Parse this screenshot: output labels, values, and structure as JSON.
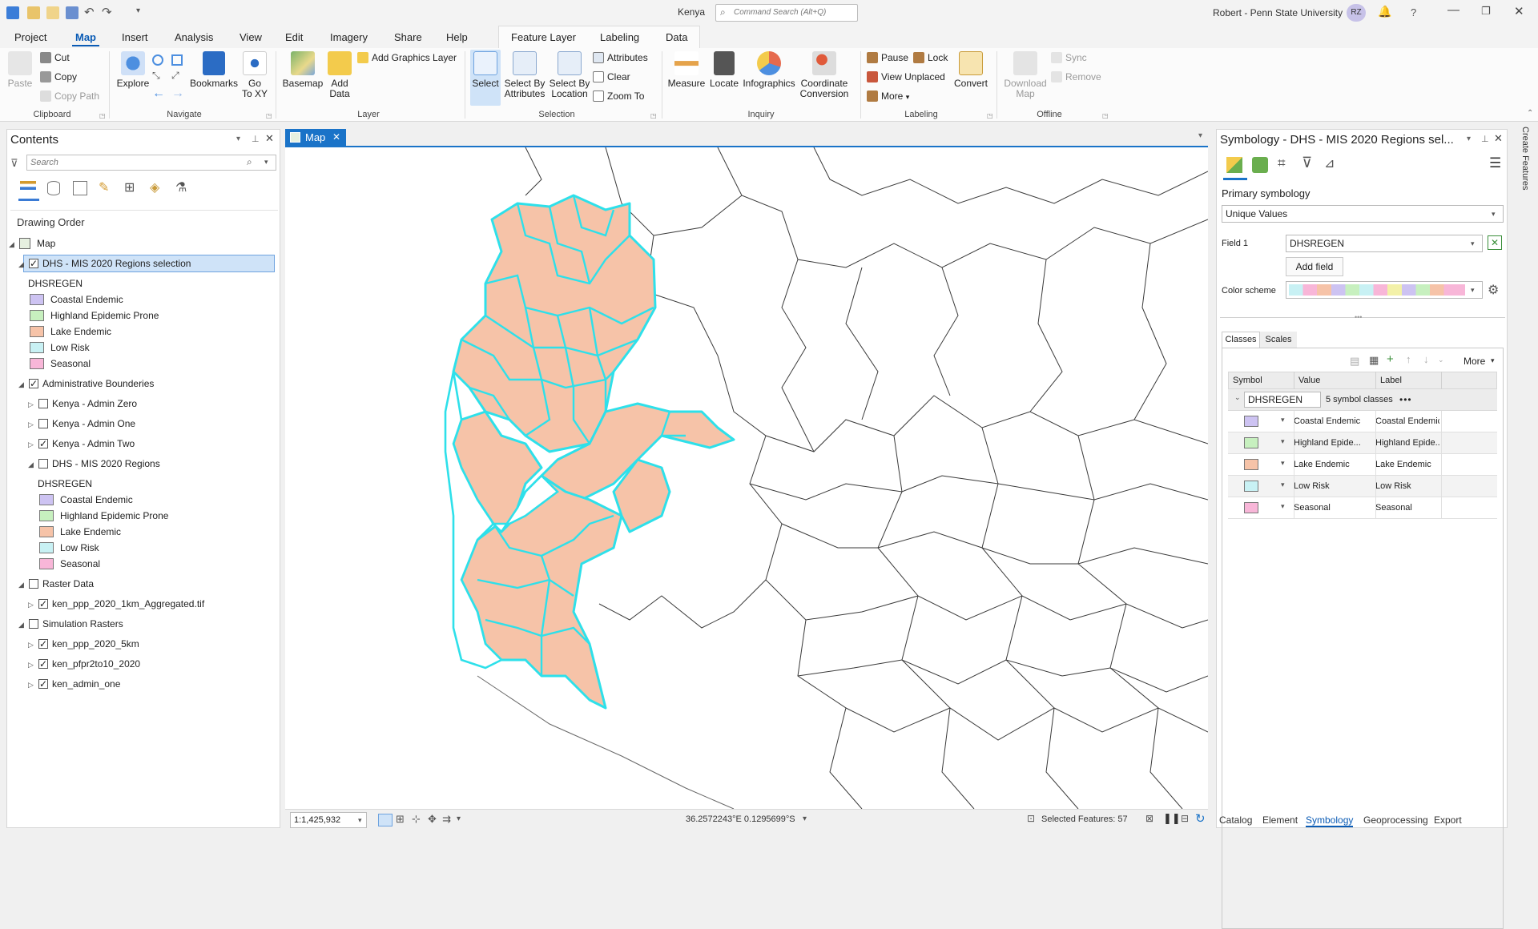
{
  "app": {
    "project_title": "Kenya",
    "command_search_placeholder": "Command Search (Alt+Q)",
    "user": "Robert - Penn State University",
    "user_initials": "RZ",
    "help_glyph": "?"
  },
  "ribbon_tabs": [
    "Project",
    "Map",
    "Insert",
    "Analysis",
    "View",
    "Edit",
    "Imagery",
    "Share",
    "Help"
  ],
  "context_tabs": [
    "Feature Layer",
    "Labeling",
    "Data"
  ],
  "ribbon": {
    "clipboard": {
      "paste": "Paste",
      "cut": "Cut",
      "copy": "Copy",
      "copy_path": "Copy Path",
      "label": "Clipboard"
    },
    "navigate": {
      "explore": "Explore",
      "bookmarks": "Bookmarks",
      "go_to_xy_1": "Go",
      "go_to_xy_2": "To XY",
      "label": "Navigate"
    },
    "layer": {
      "basemap": "Basemap",
      "add_data_1": "Add",
      "add_data_2": "Data",
      "add_graphics": "Add Graphics Layer",
      "label": "Layer"
    },
    "selection": {
      "select": "Select",
      "select_by_attr_1": "Select By",
      "select_by_attr_2": "Attributes",
      "select_by_loc_1": "Select By",
      "select_by_loc_2": "Location",
      "attributes": "Attributes",
      "clear": "Clear",
      "zoom_to": "Zoom To",
      "label": "Selection"
    },
    "inquiry": {
      "measure": "Measure",
      "locate": "Locate",
      "infographics": "Infographics",
      "coord_conv_1": "Coordinate",
      "coord_conv_2": "Conversion",
      "label": "Inquiry"
    },
    "labeling": {
      "pause": "Pause",
      "lock": "Lock",
      "view_unplaced": "View Unplaced",
      "more": "More",
      "convert": "Convert",
      "label": "Labeling"
    },
    "offline": {
      "download_1": "Download",
      "download_2": "Map",
      "sync": "Sync",
      "remove": "Remove",
      "label": "Offline"
    }
  },
  "contents": {
    "title": "Contents",
    "search_placeholder": "Search",
    "drawing_order": "Drawing Order",
    "map": "Map",
    "layer_selected": "DHS - MIS 2020 Regions selection",
    "field_name": "DHSREGEN",
    "classes": [
      "Coastal Endemic",
      "Highland Epidemic Prone",
      "Lake Endemic",
      "Low Risk",
      "Seasonal"
    ],
    "admin_group": "Administrative Bounderies",
    "admin_layers": [
      "Kenya - Admin Zero",
      "Kenya - Admin One",
      "Kenya - Admin Two",
      "DHS - MIS 2020 Regions"
    ],
    "raster_group": "Raster Data",
    "raster_layer": "ken_ppp_2020_1km_Aggregated.tif",
    "sim_group": "Simulation Rasters",
    "sim_layers": [
      "ken_ppp_2020_5km",
      "ken_pfpr2to10_2020",
      "ken_admin_one"
    ]
  },
  "class_colors": {
    "coastal": "#cdc3f2",
    "highland": "#c7f0bf",
    "lake": "#f6c3a8",
    "low": "#c8f1f4",
    "seasonal": "#f8b6d8"
  },
  "map": {
    "tab_label": "Map",
    "scale": "1:1,425,932",
    "coordinates": "36.2572243°E 0.1295699°S",
    "selected_features": "Selected Features: 57"
  },
  "symbology": {
    "title": "Symbology - DHS - MIS 2020 Regions sel...",
    "primary": "Primary symbology",
    "method": "Unique Values",
    "field1_label": "Field 1",
    "field1_value": "DHSREGEN",
    "add_field": "Add field",
    "color_scheme_label": "Color scheme",
    "tab_classes": "Classes",
    "tab_scales": "Scales",
    "more": "More",
    "col_symbol": "Symbol",
    "col_value": "Value",
    "col_label": "Label",
    "group_field": "DHSREGEN",
    "group_count": "5 symbol classes",
    "group_dots": "•••",
    "rows": [
      {
        "value": "Coastal Endemic",
        "label": "Coastal Endemic",
        "color": "#cdc3f2"
      },
      {
        "value": "Highland Epide...",
        "label": "Highland Epide...",
        "color": "#c7f0bf"
      },
      {
        "value": "Lake Endemic",
        "label": "Lake Endemic",
        "color": "#f6c3a8"
      },
      {
        "value": "Low Risk",
        "label": "Low Risk",
        "color": "#c8f1f4"
      },
      {
        "value": "Seasonal",
        "label": "Seasonal",
        "color": "#f8b6d8"
      }
    ]
  },
  "bottom_tabs": [
    "Catalog",
    "Element",
    "Symbology",
    "Geoprocessing",
    "Export"
  ],
  "right_strip_label": "Create Features"
}
